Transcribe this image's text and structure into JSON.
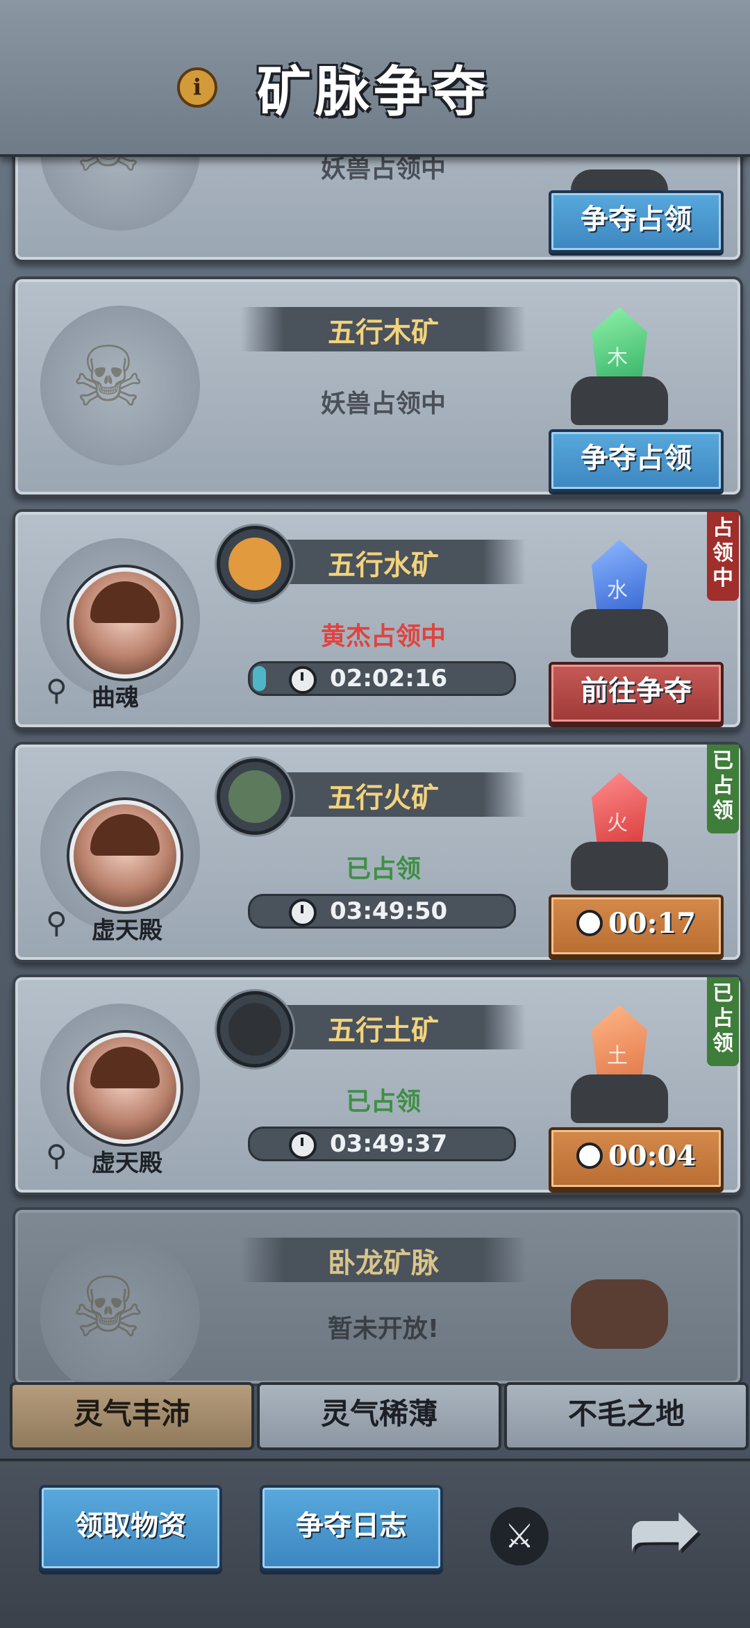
{
  "header": {
    "title": "矿脉争夺",
    "info_icon": "i"
  },
  "cards": [
    {
      "name": "",
      "status": "妖兽占领中",
      "button": "争夺占领"
    },
    {
      "name": "五行木矿",
      "status": "妖兽占领中",
      "button": "争夺占领",
      "glyph": "木"
    },
    {
      "name": "五行水矿",
      "status": "黄杰占领中",
      "button": "前往争夺",
      "glyph": "水",
      "location": "曲魂",
      "timer": "02:02:16",
      "tag": "占领中",
      "progress": 0.05
    },
    {
      "name": "五行火矿",
      "status": "已占领",
      "button": "00:17",
      "glyph": "火",
      "location": "虚天殿",
      "timer": "03:49:50",
      "tag": "已占领"
    },
    {
      "name": "五行土矿",
      "status": "已占领",
      "button": "00:04",
      "glyph": "土",
      "location": "虚天殿",
      "timer": "03:49:37",
      "tag": "已占领"
    },
    {
      "name": "卧龙矿脉",
      "status": "暂未开放!"
    }
  ],
  "tabs": [
    "灵气丰沛",
    "灵气稀薄",
    "不毛之地"
  ],
  "bottom": {
    "collect": "领取物资",
    "log": "争夺日志"
  },
  "colors": {
    "gold": "#f2d37c",
    "red_status": "#e0433f",
    "green_status": "#3f8f45",
    "blue_button": "#3c86bf",
    "red_button": "#9e3a38",
    "orange_button": "#b96d32"
  }
}
